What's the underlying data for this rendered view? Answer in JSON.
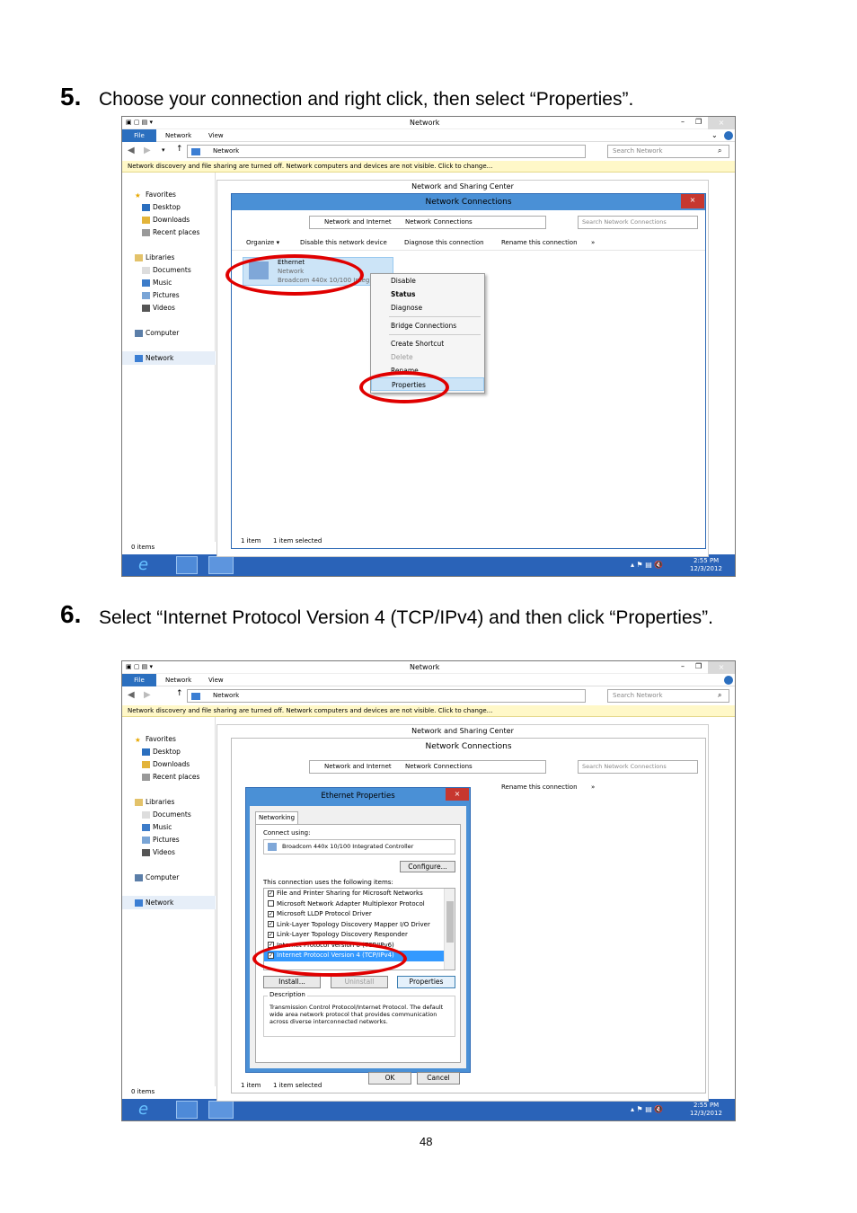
{
  "step5": {
    "number": "5.",
    "text": "Choose your connection and right click, then select “Properties”."
  },
  "step6": {
    "number": "6.",
    "text": "Select “Internet Protocol Version 4 (TCP/IPv4) and then click “Properties”."
  },
  "page_number": "48",
  "explorer": {
    "title": "Network",
    "ribbon_tabs": [
      "File",
      "Network",
      "View"
    ],
    "address": "Network",
    "search_placeholder": "Search Network",
    "infobar": "Network discovery and file sharing are turned off. Network computers and devices are not visible. Click to change...",
    "nav": {
      "favorites": "Favorites",
      "favorites_items": [
        "Desktop",
        "Downloads",
        "Recent places"
      ],
      "libraries": "Libraries",
      "libraries_items": [
        "Documents",
        "Music",
        "Pictures",
        "Videos"
      ],
      "computer": "Computer",
      "network": "Network"
    },
    "status_items": "0 items",
    "clock_time": "2:55 PM",
    "clock_date": "12/3/2012",
    "min": "–",
    "max": "❐",
    "close": "×"
  },
  "sharing_center": {
    "title": "Network and Sharing Center"
  },
  "netconn": {
    "title": "Network Connections",
    "breadcrumb": [
      "Network and Internet",
      "Network Connections"
    ],
    "search_placeholder": "Search Network Connections",
    "toolbar": [
      "Organize ▾",
      "Disable this network device",
      "Diagnose this connection",
      "Rename this connection",
      "»"
    ],
    "adapter": {
      "name": "Ethernet",
      "network": "Network",
      "device": "Broadcom 440x 10/100 Integ..."
    },
    "status_left": "1 item",
    "status_right": "1 item selected",
    "context_menu": [
      "Disable",
      "Status",
      "Diagnose",
      "Bridge Connections",
      "Create Shortcut",
      "Delete",
      "Rename",
      "Properties"
    ]
  },
  "eth_props": {
    "title": "Ethernet Properties",
    "tab": "Networking",
    "connect_using_label": "Connect using:",
    "adapter": "Broadcom 440x 10/100 Integrated Controller",
    "configure": "Configure...",
    "items_label": "This connection uses the following items:",
    "items": [
      {
        "label": "File and Printer Sharing for Microsoft Networks",
        "checked": true
      },
      {
        "label": "Microsoft Network Adapter Multiplexor Protocol",
        "checked": false
      },
      {
        "label": "Microsoft LLDP Protocol Driver",
        "checked": true
      },
      {
        "label": "Link-Layer Topology Discovery Mapper I/O Driver",
        "checked": true
      },
      {
        "label": "Link-Layer Topology Discovery Responder",
        "checked": true
      },
      {
        "label": "Internet Protocol Version 6 (TCP/IPv6)",
        "checked": true
      },
      {
        "label": "Internet Protocol Version 4 (TCP/IPv4)",
        "checked": true,
        "selected": true
      }
    ],
    "install": "Install...",
    "uninstall": "Uninstall",
    "properties": "Properties",
    "description_label": "Description",
    "description": "Transmission Control Protocol/Internet Protocol. The default wide area network protocol that provides communication across diverse interconnected networks.",
    "ok": "OK",
    "cancel": "Cancel"
  },
  "colors": {
    "accent": "#2b6fbf",
    "taskbar": "#2a63b8",
    "highlight": "#e00000"
  }
}
